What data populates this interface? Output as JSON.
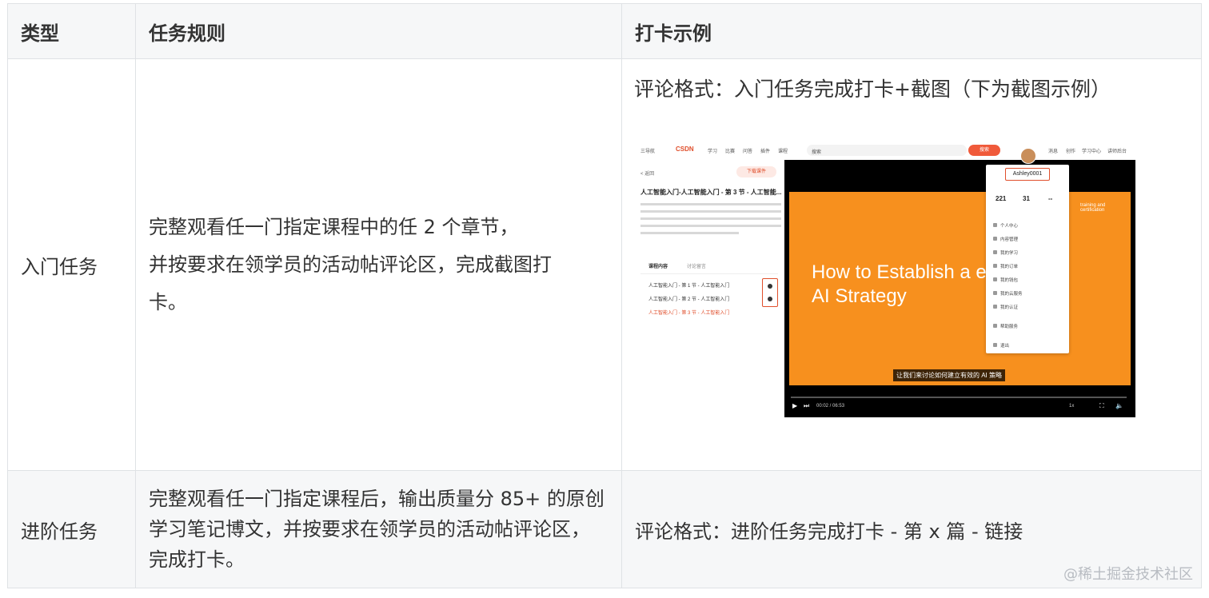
{
  "table": {
    "headers": [
      "类型",
      "任务规则",
      "打卡示例"
    ],
    "rows": [
      {
        "type": "入门任务",
        "rule_lines": [
          "完整观看任一门指定课程中的任 2 个章节，",
          "并按要求在领学员的活动帖评论区，完成截图打",
          "卡。"
        ],
        "example_format": "评论格式：入门任务完成打卡+截图（下为截图示例）"
      },
      {
        "type": "进阶任务",
        "rule_lines": [
          "完整观看任一门指定课程后，输出质量分 85+ 的原创",
          "学习笔记博文，并按要求在领学员的活动帖评论区，",
          "完成打卡。"
        ],
        "example_format": "评论格式：进阶任务完成打卡 - 第 x 篇 - 链接"
      }
    ]
  },
  "screenshot": {
    "topbar": {
      "nav": "三导航",
      "logo": "CSDN",
      "links": [
        "学习",
        "比赛",
        "问答",
        "插件",
        "课程"
      ],
      "search_placeholder": "搜索",
      "search_button": "搜索",
      "right_links": [
        "消息",
        "创作",
        "学习中心",
        "讲师后台"
      ]
    },
    "back": "< 返回",
    "download": "下载课件",
    "course_title": "人工智能入门-人工智能入门 - 第 3 节 - 人工智能...",
    "tabs": [
      "课程内容",
      "讨论留言"
    ],
    "lessons": [
      "人工智能入门 - 第 1 节 - 人工智能入门",
      "人工智能入门 - 第 2 节 - 人工智能入门",
      "人工智能入门 - 第 3 节 - 人工智能入门"
    ],
    "slide_title_lines": [
      "How to Establish a     e",
      "AI Strategy"
    ],
    "slide_brand": "training and certification",
    "subtitle": "让我们来讨论如何建立有效的 AI 策略",
    "player": {
      "time": "00:02 / 06:53",
      "speed": "1x"
    },
    "user_menu": {
      "username": "Ashley0001",
      "stats": [
        "221",
        "31",
        "--"
      ],
      "items": [
        "个人中心",
        "内容管理",
        "我的学习",
        "我的订单",
        "我的钱包",
        "我的云服务",
        "我的认证",
        "帮助服务",
        "退出"
      ]
    }
  },
  "watermark": "@稀土掘金技术社区"
}
